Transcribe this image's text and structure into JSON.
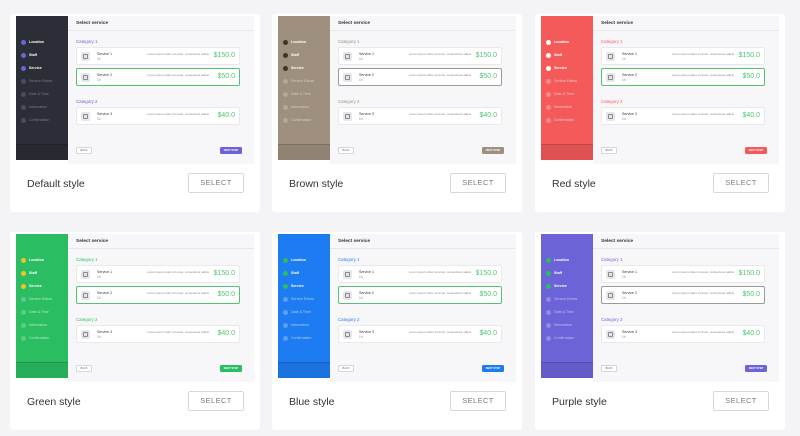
{
  "preview": {
    "title": "Select service",
    "steps": [
      "Location",
      "Staff",
      "Service",
      "Service Extras",
      "Date & Time",
      "Information",
      "Confirmation"
    ],
    "back_label": "BACK",
    "next_label": "NEXT STEP",
    "categories": [
      {
        "name": "Category 1",
        "services": [
          {
            "name": "Service 1",
            "duration": "1h",
            "desc": "Lorem ipsum dolor sit amet, consectetur adipiscing elit...",
            "price": "$150.0",
            "selected": false
          },
          {
            "name": "Service 2",
            "duration": "1h",
            "desc": "Lorem ipsum dolor sit amet, consectetur adipiscing elit...",
            "price": "$50.0",
            "selected": true
          }
        ]
      },
      {
        "name": "Category 2",
        "services": [
          {
            "name": "Service 3",
            "duration": "1h",
            "desc": "Lorem ipsum dolor sit amet, consectetur adipiscing elit...",
            "price": "$40.0",
            "selected": false
          }
        ]
      }
    ]
  },
  "select_label": "SELECT",
  "styles": [
    {
      "name": "Default style",
      "sidebar": "#2b2e36",
      "accent": "#6c63d9",
      "selectedBorder": "#53c373",
      "stepText": "#ffffff",
      "stepMuted": "#7a7d86",
      "dotDone": "#6c63d9",
      "dotTodo": "#4b4e57",
      "catColor": "#6c63d9"
    },
    {
      "name": "Brown style",
      "sidebar": "#9e8f7e",
      "accent": "#9e8f7e",
      "selectedBorder": "#9a9a9a",
      "stepText": "#ffffff",
      "stepMuted": "#d6cdc3",
      "dotDone": "#3a3530",
      "dotTodo": "#b5a897",
      "catColor": "#9e8f7e"
    },
    {
      "name": "Red style",
      "sidebar": "#f45a5a",
      "accent": "#f45a5a",
      "selectedBorder": "#53c373",
      "stepText": "#ffffff",
      "stepMuted": "#fbc3c3",
      "dotDone": "#ffffff",
      "dotTodo": "#f88a8a",
      "catColor": "#f45a5a"
    },
    {
      "name": "Green style",
      "sidebar": "#2bbd62",
      "accent": "#2bbd62",
      "selectedBorder": "#53c373",
      "stepText": "#ffffff",
      "stepMuted": "#b3e9c7",
      "dotDone": "#f4c21d",
      "dotTodo": "#5ccd86",
      "catColor": "#2bbd62"
    },
    {
      "name": "Blue style",
      "sidebar": "#1e7cf2",
      "accent": "#1e7cf2",
      "selectedBorder": "#53c373",
      "stepText": "#ffffff",
      "stepMuted": "#a9cbfa",
      "dotDone": "#2bbd62",
      "dotTodo": "#5b9ef5",
      "catColor": "#1e7cf2"
    },
    {
      "name": "Purple style",
      "sidebar": "#6c63d9",
      "accent": "#6c63d9",
      "selectedBorder": "#9a9a9a",
      "stepText": "#ffffff",
      "stepMuted": "#c2bdf0",
      "dotDone": "#2bbd62",
      "dotTodo": "#938ce3",
      "catColor": "#6c63d9"
    }
  ]
}
